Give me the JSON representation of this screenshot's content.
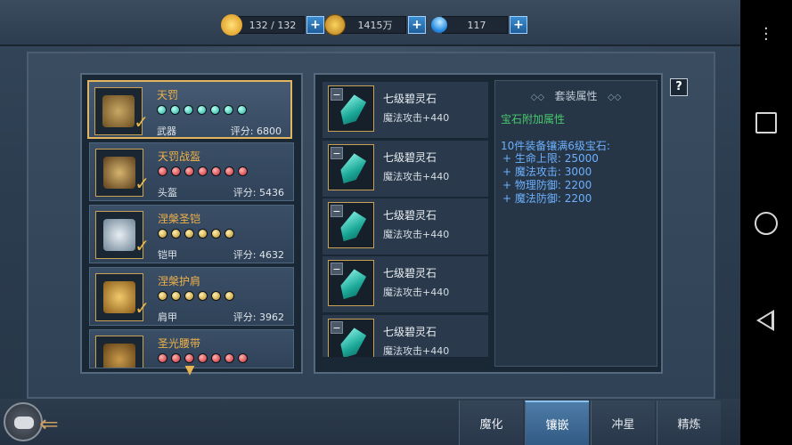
{
  "resources": {
    "energy": "132 / 132",
    "gold": "1415万",
    "diamond": "117",
    "plus": "+"
  },
  "equipment": [
    {
      "name": "天罚",
      "type": "武器",
      "score": "评分: 6800",
      "slot_color": "teal",
      "slots": 7
    },
    {
      "name": "天罚战盔",
      "type": "头盔",
      "score": "评分: 5436",
      "slot_color": "red",
      "slots": 7
    },
    {
      "name": "涅槃圣铠",
      "type": "铠甲",
      "score": "评分: 4632",
      "slot_color": "gold",
      "slots": 6
    },
    {
      "name": "涅槃护肩",
      "type": "肩甲",
      "score": "评分: 3962",
      "slot_color": "gold",
      "slots": 6
    },
    {
      "name": "圣光腰带",
      "type": "",
      "score": "",
      "slot_color": "red",
      "slots": 7
    }
  ],
  "gems": [
    {
      "name": "七级碧灵石",
      "stat": "魔法攻击+440"
    },
    {
      "name": "七级碧灵石",
      "stat": "魔法攻击+440"
    },
    {
      "name": "七级碧灵石",
      "stat": "魔法攻击+440"
    },
    {
      "name": "七级碧灵石",
      "stat": "魔法攻击+440"
    },
    {
      "name": "七级碧灵石",
      "stat": "魔法攻击+440"
    }
  ],
  "set_bonus": {
    "title": "套装属性",
    "subtitle": "宝石附加属性",
    "condition": "10件装备镶满6级宝石:",
    "stats": [
      "+ 生命上限:  25000",
      "+ 魔法攻击:  3000",
      "+ 物理防御:  2200",
      "+ 魔法防御:  2200"
    ]
  },
  "help_label": "?",
  "tabs": [
    {
      "label": "魔化",
      "active": false
    },
    {
      "label": "镶嵌",
      "active": true
    },
    {
      "label": "冲星",
      "active": false
    },
    {
      "label": "精炼",
      "active": false
    }
  ],
  "colors": {
    "selected_border": "#e3b560",
    "item_name": "#f0b24a",
    "set_green": "#48c96c",
    "set_blue": "#6db0ff",
    "tab_active": "#4e7ca8"
  },
  "icons": {
    "energy": "lightning-icon",
    "gold": "coin-icon",
    "diamond": "diamond-icon",
    "back": "gamepad-icon",
    "scroll": "chevron-down-icon"
  }
}
